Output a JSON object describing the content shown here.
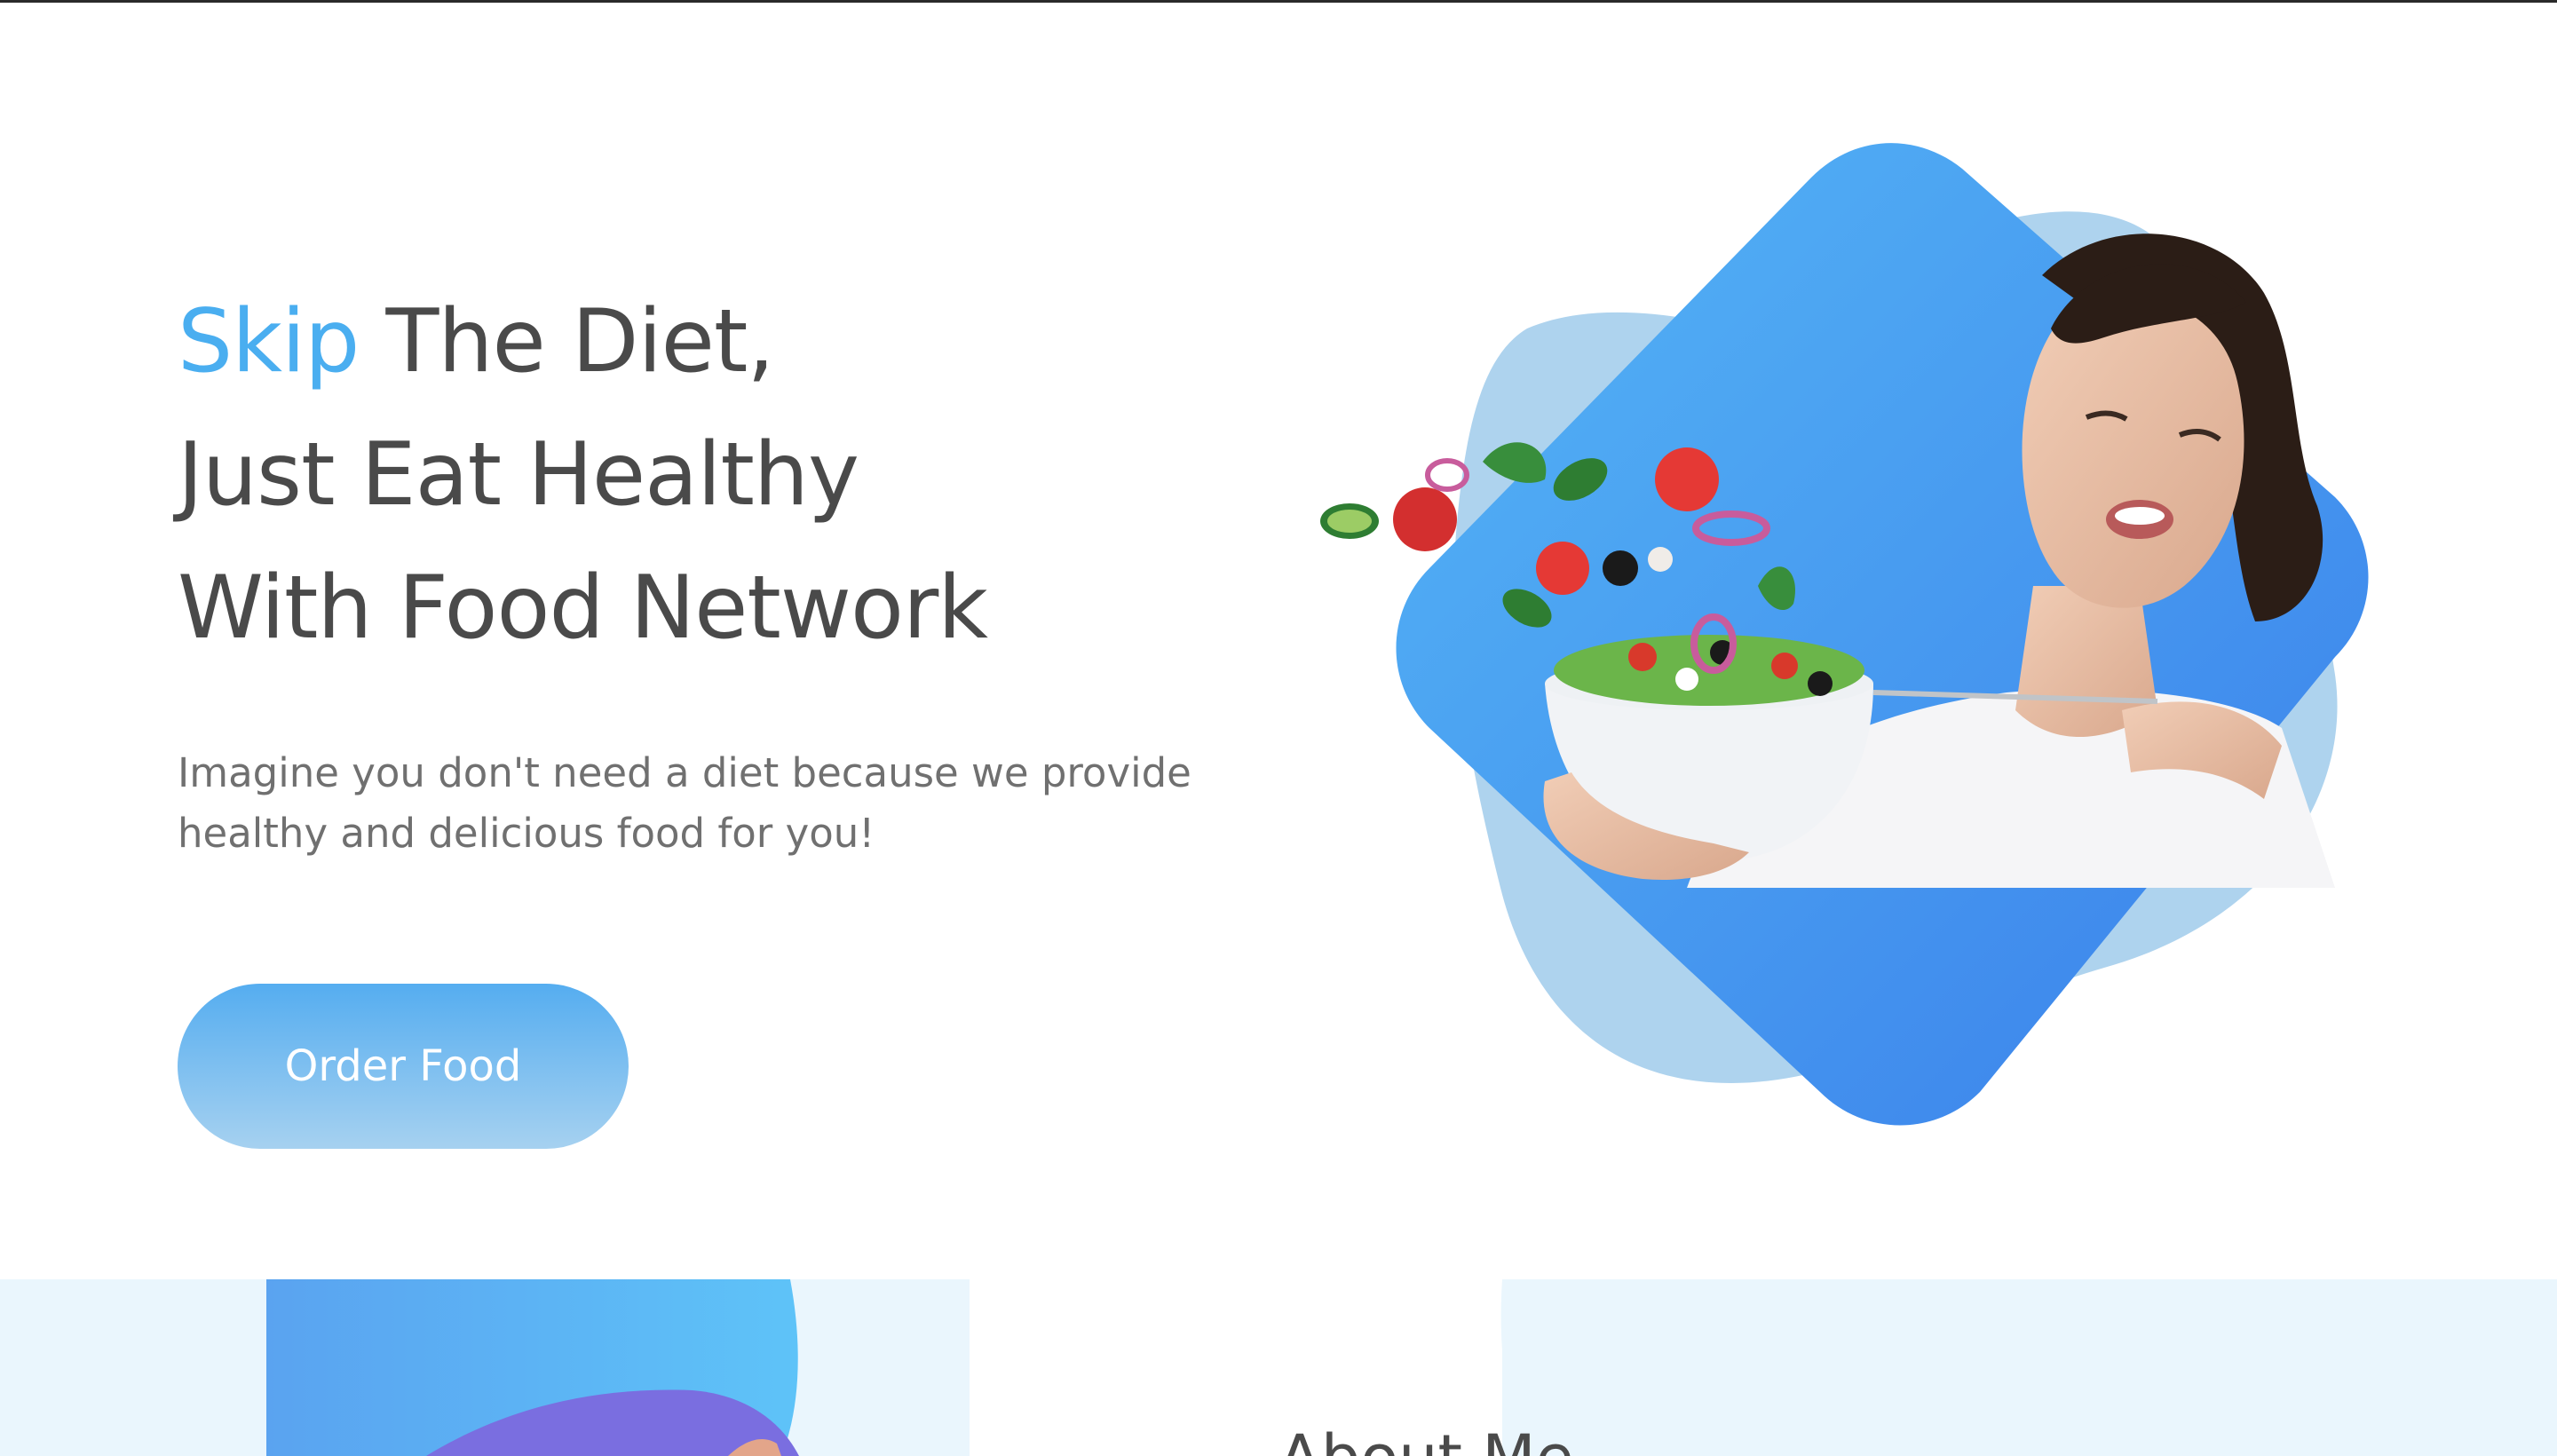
{
  "hero": {
    "title_accent": "Skip",
    "title_line1_rest": " The Diet,",
    "title_line2": "Just Eat Healthy",
    "title_line3": "With Food Network",
    "description": "Imagine you don't need a diet because we provide healthy and delicious food for you!",
    "order_button_label": "Order Food",
    "image_alt": "woman eating salad"
  },
  "about": {
    "title": "About Me"
  },
  "colors": {
    "accent": "#4aaef0",
    "heading": "#4a4a4a",
    "body_text": "#707070",
    "blob_blue": "#3f94ee",
    "blob_light": "#a9d1ec",
    "about_bg": "#eaf6fd"
  }
}
